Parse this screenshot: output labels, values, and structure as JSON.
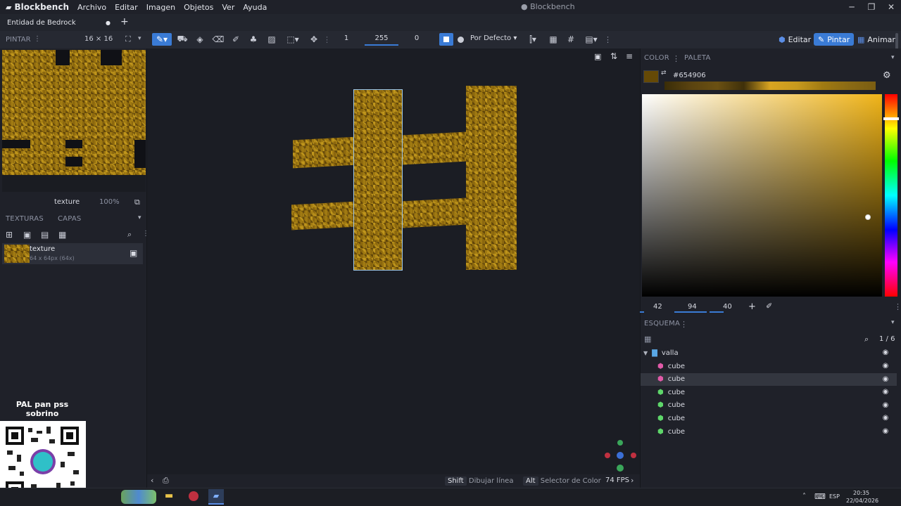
{
  "app": {
    "name": "Blockbench",
    "window_title": "● Blockbench",
    "menu": [
      "Archivo",
      "Editar",
      "Imagen",
      "Objetos",
      "Ver",
      "Ayuda"
    ]
  },
  "tab": {
    "label": "Entidad de Bedrock",
    "dot": "●",
    "add": "+"
  },
  "toolbar": {
    "panel_label": "PINTAR",
    "canvas_size": "16 × 16",
    "brush_size": "1",
    "opacity": "255",
    "softness": "0",
    "blend_mode": "Por Defecto",
    "modes": [
      {
        "label": "Editar",
        "active": false
      },
      {
        "label": "Pintar",
        "active": true
      },
      {
        "label": "Animar",
        "active": false
      }
    ]
  },
  "left_panel": {
    "texture_name": "texture",
    "zoom": "100%",
    "tabs": [
      "TEXTURAS",
      "CAPAS"
    ],
    "texture_item": {
      "name": "texture",
      "size": "64 x 64px (64x)"
    }
  },
  "color_panel": {
    "tabs": [
      "COLOR",
      "PALETA"
    ],
    "hex": "#654906",
    "main_color": "#654906",
    "hue_color": "#f0b418",
    "hsv": {
      "h": "42",
      "s": "94",
      "v": "40"
    }
  },
  "outliner": {
    "title": "ESQUEMA",
    "count": "1 / 6",
    "group": "valla",
    "items": [
      {
        "name": "cube",
        "color": "#e05aa8",
        "selected": false
      },
      {
        "name": "cube",
        "color": "#e05aa8",
        "selected": true
      },
      {
        "name": "cube",
        "color": "#5ed66a",
        "selected": false
      },
      {
        "name": "cube",
        "color": "#5ed66a",
        "selected": false
      },
      {
        "name": "cube",
        "color": "#5ed66a",
        "selected": false
      },
      {
        "name": "cube",
        "color": "#5ed66a",
        "selected": false
      }
    ]
  },
  "status_bar": {
    "hints": [
      {
        "key": "Shift",
        "action": "Dibujar línea"
      },
      {
        "key": "Alt",
        "action": "Selector de Color"
      }
    ],
    "fps": "74 FPS"
  },
  "overlay": {
    "text": "PAL pan pss sobrino"
  },
  "taskbar": {
    "lang": "ESP",
    "time": "20:35",
    "date": "22/04/2026"
  },
  "colors": {
    "accent": "#3a7bd5",
    "bg": "#1b1d24",
    "panel": "#1f2129"
  }
}
